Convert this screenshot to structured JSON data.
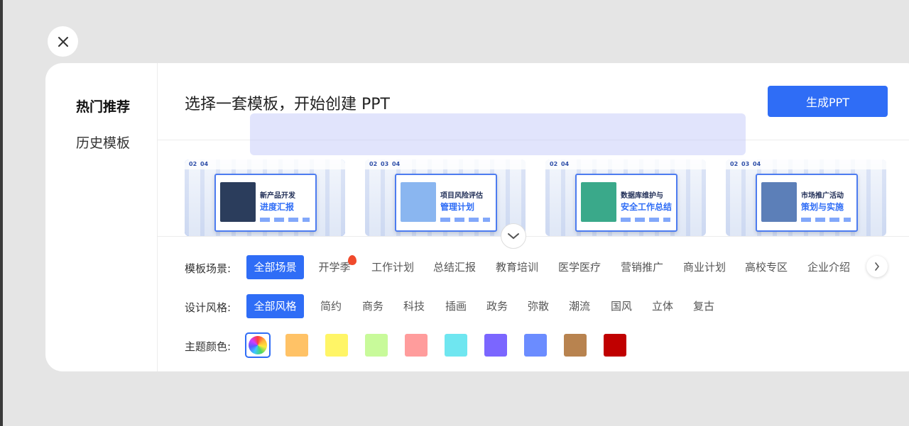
{
  "sidebar": {
    "items": [
      {
        "label": "热门推荐",
        "active": true
      },
      {
        "label": "历史模板",
        "active": false
      }
    ]
  },
  "header": {
    "title": "选择一套模板，开始创建 PPT",
    "generate_label": "生成PPT"
  },
  "templates": [
    {
      "nums": [
        "02",
        "04"
      ],
      "line1": "新产品开发",
      "line2": "进度汇报",
      "thumb_color": "#2b3d5c",
      "selected": true
    },
    {
      "nums": [
        "02",
        "03",
        "04"
      ],
      "line1": "项目风险评估",
      "line2": "管理计划",
      "thumb_color": "#8ab6f0",
      "selected": false
    },
    {
      "nums": [
        "02",
        "04"
      ],
      "line1": "数据库维护与",
      "line2": "安全工作总结",
      "thumb_color": "#3aa98a",
      "selected": false
    },
    {
      "nums": [
        "02",
        "03",
        "04"
      ],
      "line1": "市场推广活动",
      "line2": "策划与实施",
      "thumb_color": "#5c7fb8",
      "selected": false
    }
  ],
  "filters": {
    "scene": {
      "label": "模板场景:",
      "options": [
        "全部场景",
        "开学季",
        "工作计划",
        "总结汇报",
        "教育培训",
        "医学医疗",
        "营销推广",
        "商业计划",
        "高校专区",
        "企业介绍"
      ],
      "active_index": 0,
      "hot_index": 1
    },
    "style": {
      "label": "设计风格:",
      "options": [
        "全部风格",
        "简约",
        "商务",
        "科技",
        "插画",
        "政务",
        "弥散",
        "潮流",
        "国风",
        "立体",
        "复古"
      ],
      "active_index": 0
    },
    "color": {
      "label": "主题颜色:",
      "swatches": [
        "#ffc266",
        "#fff566",
        "#c8fa9a",
        "#ff9c9c",
        "#6fe6f0",
        "#7b66ff",
        "#6b8cff",
        "#b8834f",
        "#c00000"
      ]
    }
  },
  "colors": {
    "accent": "#2f6df6"
  }
}
